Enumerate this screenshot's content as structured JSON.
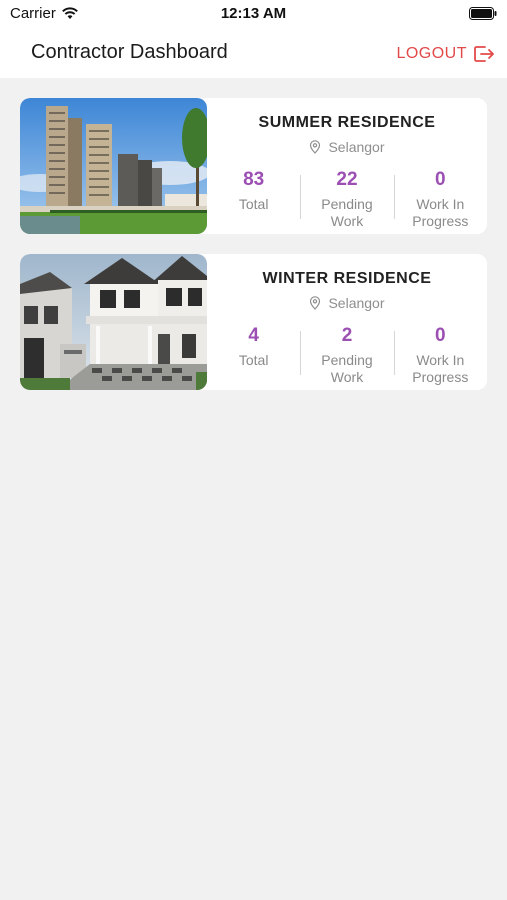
{
  "status_bar": {
    "carrier": "Carrier",
    "time": "12:13 AM"
  },
  "header": {
    "title": "Contractor Dashboard",
    "logout_label": "LOGOUT",
    "accent_color": "#e24a4a"
  },
  "properties": [
    {
      "name": "SUMMER RESIDENCE",
      "location": "Selangor",
      "stats": [
        {
          "value": "83",
          "label": "Total"
        },
        {
          "value": "22",
          "label": "Pending\nWork"
        },
        {
          "value": "0",
          "label": "Work In\nProgress"
        }
      ]
    },
    {
      "name": "WINTER RESIDENCE",
      "location": "Selangor",
      "stats": [
        {
          "value": "4",
          "label": "Total"
        },
        {
          "value": "2",
          "label": "Pending\nWork"
        },
        {
          "value": "0",
          "label": "Work In\nProgress"
        }
      ]
    }
  ],
  "colors": {
    "stat_value": "#9b4fb3",
    "background": "#f1f1f1"
  }
}
